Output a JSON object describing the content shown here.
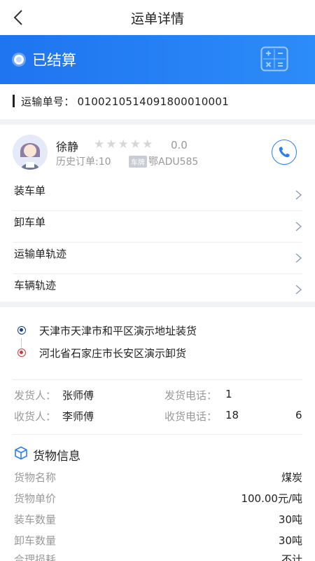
{
  "header": {
    "title": "运单详情"
  },
  "status": {
    "text": "已结算",
    "icon": "calculator-icon"
  },
  "waybill": {
    "label": "运输单号：",
    "number": "0100210514091800010001"
  },
  "driver": {
    "name": "徐静",
    "stars_filled": 0,
    "stars_total": 5,
    "rating": "0.0",
    "history": "历史订单:10",
    "plate_tag": "车牌",
    "plate": "鄂ADU585"
  },
  "menu": [
    {
      "label": "装车单"
    },
    {
      "label": "卸车单"
    },
    {
      "label": "运输单轨迹"
    },
    {
      "label": "车辆轨迹"
    }
  ],
  "route": {
    "load": "天津市天津市和平区演示地址装货",
    "unload": "河北省石家庄市长安区演示卸货"
  },
  "contacts": {
    "shipper_label": "发货人：",
    "shipper": "张师傅",
    "shipper_phone_label": "发货电话：",
    "shipper_phone": "1",
    "receiver_label": "收货人：",
    "receiver": "李师傅",
    "receiver_phone_label": "收货电话：",
    "receiver_phone_start": "18",
    "receiver_phone_end": "6"
  },
  "goods": {
    "title": "货物信息",
    "rows": [
      {
        "label": "货物名称",
        "value": "煤炭"
      },
      {
        "label": "货物单价",
        "value": "100.00元/吨"
      },
      {
        "label": "装车数量",
        "value": "30吨"
      },
      {
        "label": "卸车数量",
        "value": "30吨"
      },
      {
        "label": "合理损耗",
        "value": "不计"
      }
    ]
  },
  "colors": {
    "primary": "#2680f5",
    "load_dot": "#1a3f8c",
    "unload_dot": "#d23a3a"
  }
}
